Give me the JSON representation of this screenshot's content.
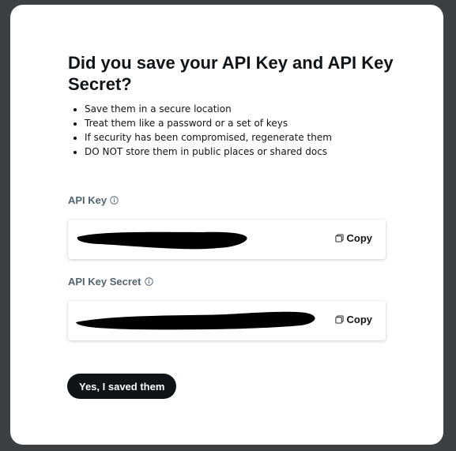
{
  "modal": {
    "title": "Did you save your API Key and API Key Secret?",
    "bullets": [
      "Save them in a secure location",
      "Treat them like a password or a set of keys",
      "If security has been compromised, regenerate them",
      "DO NOT store them in public places or shared docs"
    ],
    "api_key": {
      "label": "API Key",
      "value_redacted": true,
      "copy_label": "Copy"
    },
    "api_key_secret": {
      "label": "API Key Secret",
      "value_redacted": true,
      "copy_label": "Copy"
    },
    "confirm_label": "Yes, I saved them"
  },
  "colors": {
    "backdrop": "#3c4043",
    "text_primary": "#0f1419",
    "text_secondary": "#536471",
    "button_bg": "#0f1419",
    "button_text": "#ffffff",
    "redaction": "#000000"
  },
  "icons": {
    "info": "info-circle-icon",
    "copy": "copy-icon"
  }
}
